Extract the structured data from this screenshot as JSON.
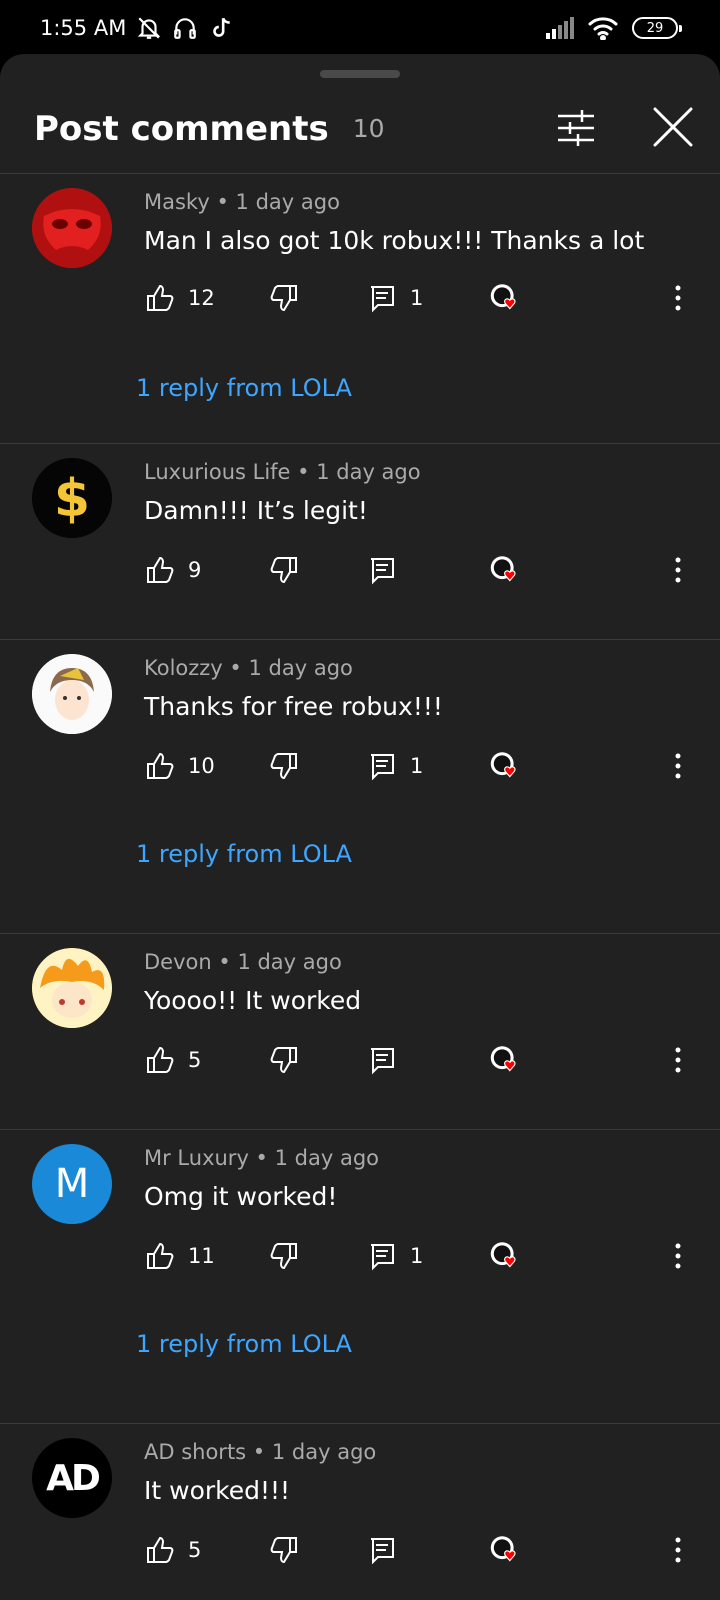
{
  "status_bar": {
    "time": "1:55 AM",
    "battery": "29"
  },
  "header": {
    "title": "Post comments",
    "count": "10"
  },
  "comments": [
    {
      "author": "Masky",
      "time": "1 day ago",
      "text": "Man I also got 10k robux!!! Thanks a lot",
      "likes": "12",
      "replies": "1",
      "reply_link": "1 reply from LOLA",
      "avatar": "red-mask"
    },
    {
      "author": "Luxurious Life",
      "time": "1 day ago",
      "text": "Damn!!! It’s legit!",
      "likes": "9",
      "replies": "",
      "reply_link": "",
      "avatar": "dollar"
    },
    {
      "author": "Kolozzy",
      "time": "1 day ago",
      "text": "Thanks for free robux!!!",
      "likes": "10",
      "replies": "1",
      "reply_link": "1 reply from LOLA",
      "avatar": "anime-boy"
    },
    {
      "author": "Devon",
      "time": "1 day ago",
      "text": "Yoooo!! It worked",
      "likes": "5",
      "replies": "",
      "reply_link": "",
      "avatar": "fire-face"
    },
    {
      "author": "Mr Luxury",
      "time": "1 day ago",
      "text": "Omg it worked!",
      "likes": "11",
      "replies": "1",
      "reply_link": "1 reply from LOLA",
      "avatar": "letter-m",
      "avatar_letter": "M"
    },
    {
      "author": "AD shorts",
      "time": "1 day ago",
      "text": "It worked!!!",
      "likes": "5",
      "replies": "",
      "reply_link": "",
      "avatar": "ad-logo",
      "avatar_letter": "AD"
    }
  ],
  "colors": {
    "background": "#212121",
    "link": "#3ea6ff",
    "secondary_text": "#aaaaaa",
    "heart": "#ff0000"
  }
}
